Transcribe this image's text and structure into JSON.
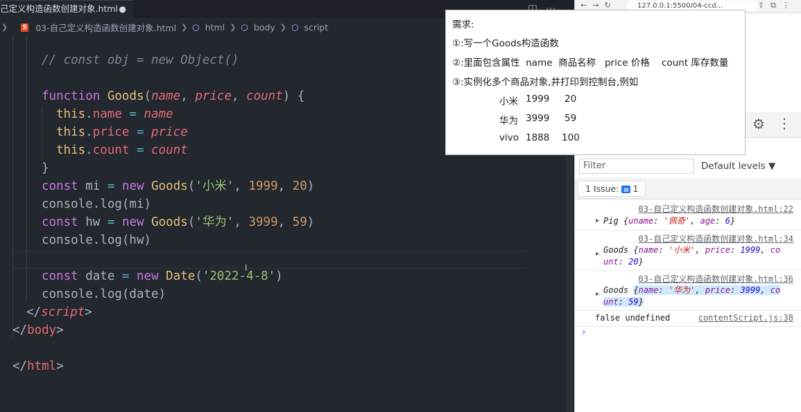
{
  "editor": {
    "tab_title": "己定义构造函数创建对象.html",
    "tab_dirty": "●",
    "breadcrumb": {
      "file": "03-自己定义构造函数创建对象.html",
      "items": [
        "html",
        "body",
        "script"
      ]
    }
  },
  "code": {
    "comment": "// const obj = new Object()",
    "fn_keyword": "function",
    "fn_name": "Goods",
    "params": [
      "name",
      "price",
      "count"
    ],
    "this_kw": "this",
    "mi_label": "'小米'",
    "mi_price": "1999",
    "mi_count": "20",
    "hw_label": "'华为'",
    "hw_price": "3999",
    "hw_count": "59",
    "date_str": "'2022-4-8'",
    "script_tag": "script",
    "body_tag": "body",
    "html_tag": "html"
  },
  "browser": {
    "url": "127.0.0.1:5500/04-ccd...",
    "filter_placeholder": "Filter",
    "levels_label": "Default levels ▼",
    "issues_label": "1 Issue:",
    "issues_count": "1"
  },
  "console": {
    "messages": [
      {
        "source": "03-自己定义构造函数创建对象.html:22",
        "text": "Pig {uname: '佩奇', age: 6}"
      },
      {
        "source": "03-自己定义构造函数创建对象.html:34",
        "text": "Goods {name: '小米', price: 1999, count: 20}"
      },
      {
        "source": "03-自己定义构造函数创建对象.html:36",
        "text": "Goods {name: '华为', price: 3999, count: 59}"
      },
      {
        "source": "contentScript.js:38",
        "text": "false undefined"
      }
    ]
  },
  "requirements": {
    "title": "需求:",
    "items": [
      "①:写一个Goods构造函数",
      "②:里面包含属性  name  商品名称   price 价格    count 库存数量",
      "③:实例化多个商品对象,并打印到控制台,例如"
    ],
    "examples": [
      {
        "name": "小米",
        "price": "1999",
        "count": "20"
      },
      {
        "name": "华为",
        "price": "3999",
        "count": "59"
      },
      {
        "name": "vivo",
        "price": "1888",
        "count": "100"
      }
    ]
  }
}
